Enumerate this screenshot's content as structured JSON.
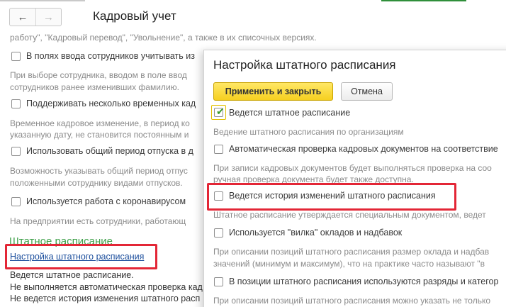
{
  "window": {
    "title": "Кадровый учет",
    "nav_back_icon": "arrow-left-icon",
    "nav_forward_icon": "arrow-right-icon"
  },
  "background": {
    "intro_text": "работу\", \"Кадровый перевод\", \"Увольнение\", а также в их списочных версиях.",
    "options": [
      {
        "label": "В полях ввода сотрудников учитывать из",
        "checked": false,
        "desc": [
          "При выборе сотрудника, вводом в поле ввод",
          "сотрудников ранее изменивших фамилию."
        ]
      },
      {
        "label": "Поддерживать несколько временных кад",
        "checked": false,
        "desc": [
          "Временное кадровое изменение, в период ко",
          "указанную дату, не становится постоянным и"
        ]
      },
      {
        "label": "Использовать общий период отпуска в д",
        "checked": false,
        "desc": [
          "Возможность указывать общий период отпус",
          "положенными сотруднику видами отпусков."
        ]
      },
      {
        "label": "Используется работа с коронавирусом",
        "checked": false,
        "desc": [
          "На предприятии есть сотрудники, работающ"
        ]
      }
    ],
    "section_title": "Штатное расписание",
    "settings_link": "Настройка штатного расписания",
    "status_lines": [
      "Ведется штатное расписание.",
      "Не выполняется автоматическая проверка кад",
      "Не ведется история изменения штатного расп"
    ]
  },
  "modal": {
    "title": "Настройка штатного расписания",
    "apply_close_label": "Применить и закрыть",
    "cancel_label": "Отмена",
    "options": [
      {
        "label": "Ведется штатное расписание",
        "checked": true,
        "desc": [
          "Ведение штатного расписания по организациям"
        ]
      },
      {
        "label": "Автоматическая проверка кадровых документов на соответствие",
        "checked": false,
        "desc": [
          "При записи кадровых документов будет выполняться проверка на соо",
          "ручная проверка документа будет также доступна."
        ]
      },
      {
        "label": "Ведется история изменений штатного расписания",
        "checked": false,
        "desc": [
          "Штатное расписание утверждается специальным документом, ведет"
        ]
      },
      {
        "label": "Используется \"вилка\" окладов и надбавок",
        "checked": false,
        "desc": [
          "При описании позиций штатного расписания размер оклада и надбав",
          "значений (минимум и максимум), что на практике часто называют \"в"
        ]
      },
      {
        "label": "В позиции штатного расписания используются разряды и категор",
        "checked": false,
        "desc": [
          "При описании позиций штатного расписания можно указать не только"
        ]
      }
    ]
  },
  "colors": {
    "section_green": "#3fa04a",
    "link_blue": "#1a4d9c",
    "highlight_red": "#e32636",
    "primary_yellow": "#f6d020",
    "check_green": "#3c9a2c"
  }
}
